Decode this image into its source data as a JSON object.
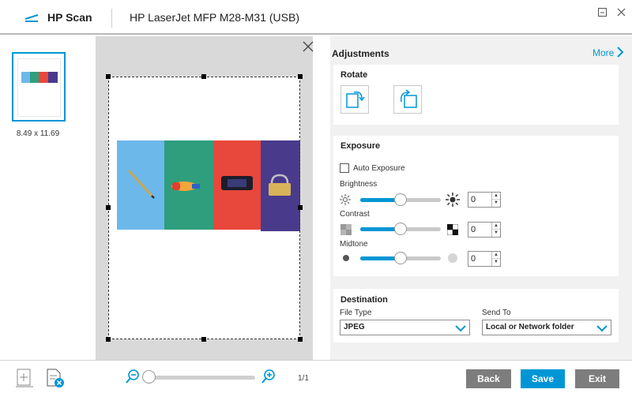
{
  "titlebar": {
    "app_name": "HP Scan",
    "device_name": "HP LaserJet MFP M28-M31 (USB)"
  },
  "thumbnail": {
    "caption": "8.49  x  11.69"
  },
  "adjustments": {
    "title": "Adjustments",
    "more_label": "More"
  },
  "rotate": {
    "title": "Rotate"
  },
  "exposure": {
    "title": "Exposure",
    "auto_exposure_label": "Auto Exposure",
    "auto_exposure_checked": false,
    "brightness_label": "Brightness",
    "brightness_value": "0",
    "contrast_label": "Contrast",
    "contrast_value": "0",
    "midtone_label": "Midtone",
    "midtone_value": "0",
    "slider_position_fraction": 0.5
  },
  "destination": {
    "title": "Destination",
    "file_type_label": "File Type",
    "file_type_value": "JPEG",
    "send_to_label": "Send To",
    "send_to_value": "Local or Network folder"
  },
  "bottom": {
    "page_count": "1/1",
    "back_label": "Back",
    "save_label": "Save",
    "exit_label": "Exit"
  },
  "colors": {
    "accent": "#0096d6",
    "button_grey": "#7d7d7d",
    "panel_bg": "#f1f1f1",
    "preview_bg": "#d9d9d9"
  }
}
